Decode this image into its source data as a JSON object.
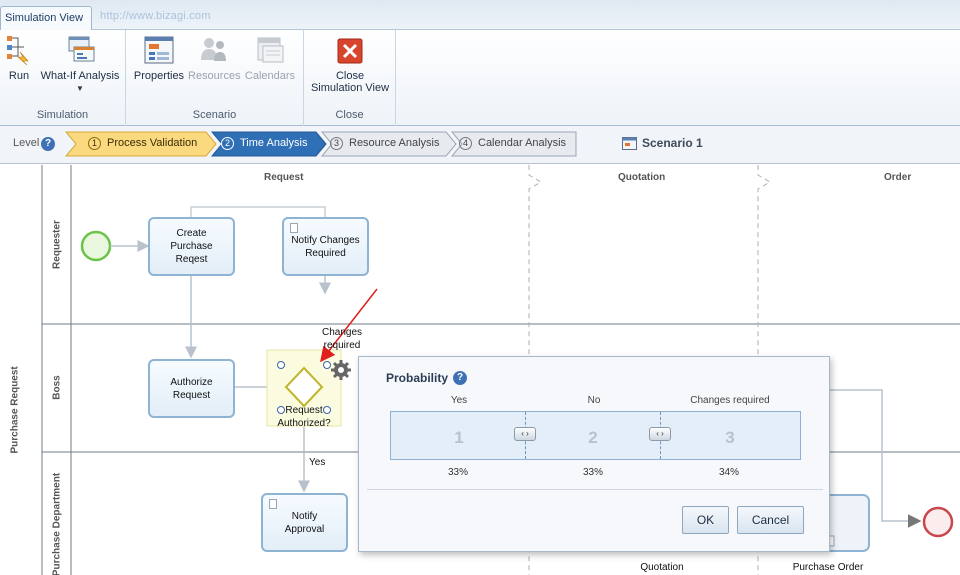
{
  "ribbon": {
    "active_tab": "Simulation View",
    "url_text": "http://www.bizagi.com",
    "groups": {
      "simulation": {
        "label": "Simulation",
        "run": "Run",
        "what_if": "What-If Analysis"
      },
      "scenario": {
        "label": "Scenario",
        "properties": "Properties",
        "resources": "Resources",
        "calendars": "Calendars"
      },
      "close": {
        "label": "Close",
        "close_line1": "Close",
        "close_line2": "Simulation View"
      }
    }
  },
  "levels": {
    "label": "Level",
    "steps": [
      {
        "num": "1",
        "label": "Process Validation"
      },
      {
        "num": "2",
        "label": "Time Analysis"
      },
      {
        "num": "3",
        "label": "Resource Analysis"
      },
      {
        "num": "4",
        "label": "Calendar Analysis"
      }
    ],
    "scenario": "Scenario 1"
  },
  "diagram": {
    "pool": "Purchase Request",
    "lanes": [
      "Requester",
      "Boss",
      "Purchase Department"
    ],
    "columns": [
      "Request",
      "Quotation",
      "Order"
    ],
    "tasks": {
      "create": [
        "Create",
        "Purchase",
        "Reqest"
      ],
      "notify_changes": [
        "Notify Changes",
        "Required"
      ],
      "authorize": [
        "Authorize",
        "Request"
      ],
      "notify_approval": [
        "Notify",
        "Approval"
      ]
    },
    "gateway": [
      "Request",
      "Authorized?"
    ],
    "flow_changes": [
      "Changes",
      "required"
    ],
    "flow_yes": "Yes",
    "bottom_labels": [
      "Quotation",
      "Purchase Order"
    ]
  },
  "probability": {
    "title": "Probability",
    "columns": [
      "Yes",
      "No",
      "Changes required"
    ],
    "numbers": [
      "1",
      "2",
      "3"
    ],
    "percentages": [
      "33%",
      "33%",
      "34%"
    ],
    "ok": "OK",
    "cancel": "Cancel"
  },
  "colors": {
    "accent_blue": "#2f6fb5",
    "step_validation": "#fbd97f",
    "task_border": "#8fb3d3",
    "start_event": "#7fcf5a",
    "end_event": "#c8474c",
    "gateway": "#d7d02a"
  }
}
